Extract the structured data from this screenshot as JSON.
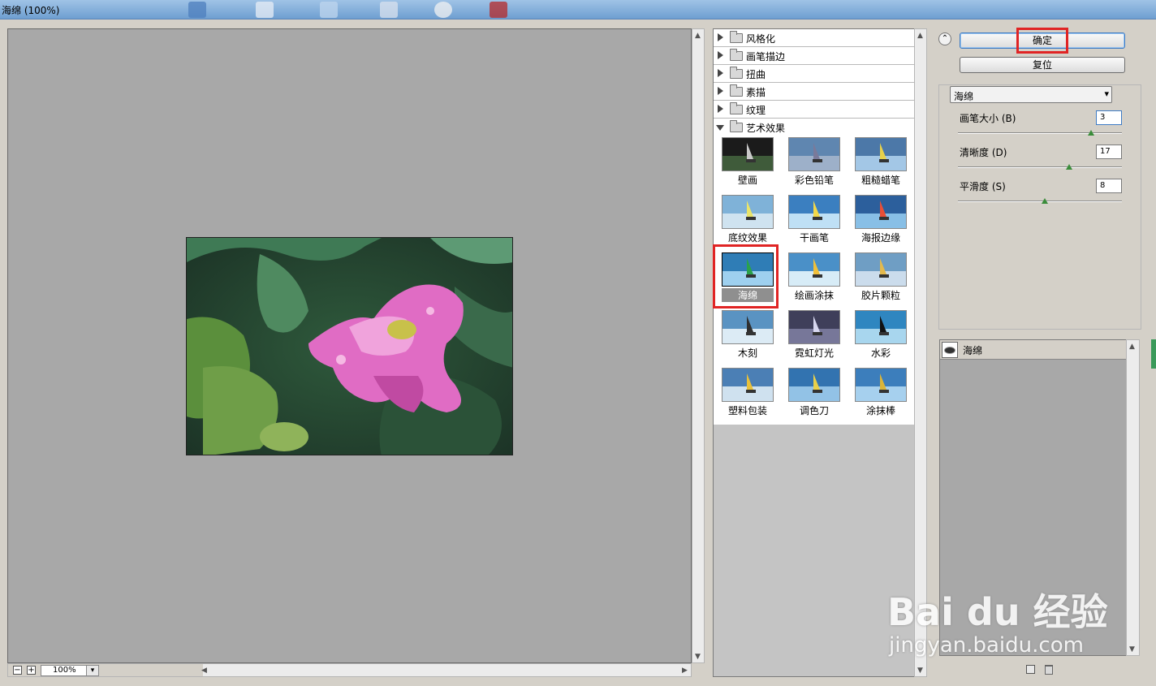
{
  "window": {
    "title": "海绵 (100%)"
  },
  "preview": {
    "zoom_value": "100%",
    "zoom_out": "−",
    "zoom_in": "+",
    "dropdown_arrow": "▾"
  },
  "categories": [
    {
      "label": "风格化",
      "expanded": false
    },
    {
      "label": "画笔描边",
      "expanded": false
    },
    {
      "label": "扭曲",
      "expanded": false
    },
    {
      "label": "素描",
      "expanded": false
    },
    {
      "label": "纹理",
      "expanded": false
    },
    {
      "label": "艺术效果",
      "expanded": true
    }
  ],
  "filters": [
    {
      "label": "壁画"
    },
    {
      "label": "彩色铅笔"
    },
    {
      "label": "粗糙蜡笔"
    },
    {
      "label": "底纹效果"
    },
    {
      "label": "干画笔"
    },
    {
      "label": "海报边缘"
    },
    {
      "label": "海绵",
      "selected": true
    },
    {
      "label": "绘画涂抹"
    },
    {
      "label": "胶片颗粒"
    },
    {
      "label": "木刻"
    },
    {
      "label": "霓虹灯光"
    },
    {
      "label": "水彩"
    },
    {
      "label": "塑料包装"
    },
    {
      "label": "调色刀"
    },
    {
      "label": "涂抹棒"
    }
  ],
  "buttons": {
    "ok": "确定",
    "reset": "复位",
    "collapse": "⌃"
  },
  "filter_select": {
    "value": "海绵",
    "arrow": "▾"
  },
  "params": [
    {
      "label": "画笔大小",
      "hotkey": "(B)",
      "value": "3",
      "level": 0.81
    },
    {
      "label": "清晰度",
      "hotkey": "(D)",
      "value": "17",
      "level": 0.68
    },
    {
      "label": "平滑度",
      "hotkey": "(S)",
      "value": "8",
      "level": 0.53
    }
  ],
  "layers": {
    "items": [
      {
        "name": "海绵"
      }
    ]
  },
  "watermark": {
    "brand": "Bai du 经验",
    "url": "jingyan.baidu.com"
  },
  "colors": {
    "highlight_red": "#e02424",
    "preview_bg": "#a8a8a8"
  }
}
